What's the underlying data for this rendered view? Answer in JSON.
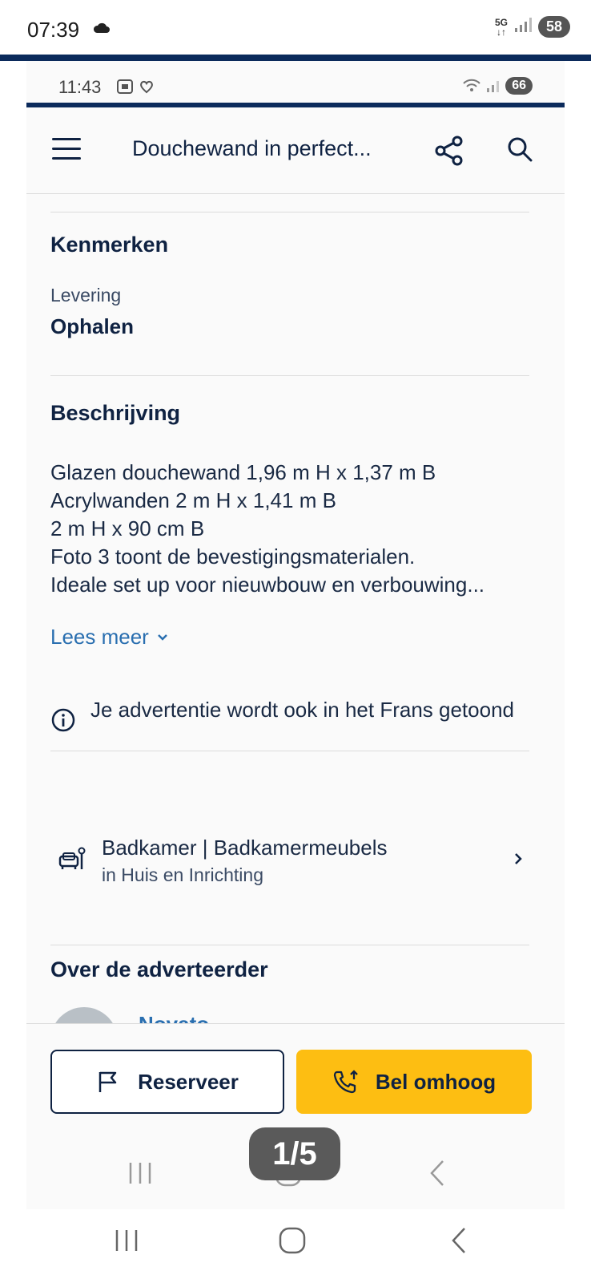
{
  "outer_status": {
    "time": "07:39",
    "network": "5G",
    "battery": "58"
  },
  "inner_status": {
    "time": "11:43",
    "battery": "66"
  },
  "appbar": {
    "title": "Douchewand in perfect..."
  },
  "kenmerken": {
    "heading": "Kenmerken",
    "levering_label": "Levering",
    "levering_value": "Ophalen"
  },
  "beschrijving": {
    "heading": "Beschrijving",
    "lines": [
      "Glazen douchewand 1,96 m H x 1,37 m B",
      "Acrylwanden 2 m H x 1,41 m B",
      "2 m H x 90 cm B",
      "Foto 3 toont de bevestigingsmaterialen.",
      "Ideale set up voor nieuwbouw en verbouwing..."
    ],
    "read_more": "Lees meer"
  },
  "info_notice": {
    "text": "Je advertentie wordt ook in het Frans getoond"
  },
  "category": {
    "title": "Badkamer | Badkamermeubels",
    "subtitle": "in Huis en Inrichting"
  },
  "advertiser": {
    "heading": "Over de adverteerder",
    "name": "Novato"
  },
  "actions": {
    "reserve": "Reserveer",
    "bump": "Bel omhoog",
    "bump_color": "#fdbe12"
  },
  "pager": {
    "label": "1/5"
  },
  "colors": {
    "navy": "#0b2a5b",
    "link": "#2a6fb0",
    "text": "#0f2242"
  }
}
